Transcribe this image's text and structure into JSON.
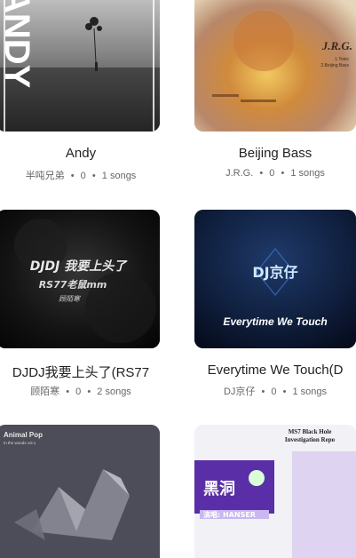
{
  "albums": [
    {
      "title": "Andy",
      "artist": "半吨兄弟",
      "plays": "0",
      "songs": "1 songs",
      "cover_text": "ANDY",
      "cover_accent": "#ffffff"
    },
    {
      "title": "Beijing Bass",
      "artist": "J.R.G.",
      "plays": "0",
      "songs": "1 songs",
      "cover_text": "J.R.G.",
      "cover_sub": "1.Tonic\n2.Beijing Bass",
      "cover_accent": "#e0b04c"
    },
    {
      "title": "DJDJ我要上头了(RS77",
      "artist": "顾陌寒",
      "plays": "0",
      "songs": "2 songs",
      "cover_lines": [
        "DJDJ 我要上头了",
        "RS77老鼠mm",
        "顾陌寒"
      ]
    },
    {
      "title": "Everytime We Touch(D",
      "artist": "DJ京仔",
      "plays": "0",
      "songs": "1 songs",
      "cover_logo": "DJ京仔",
      "cover_line": "Everytime We Touch"
    },
    {
      "title": "",
      "artist": "",
      "plays": "",
      "songs": "",
      "cover_text": "Animal Pop",
      "cover_sub": "In the woods vol.1"
    },
    {
      "title": "",
      "artist": "",
      "plays": "",
      "songs": "",
      "cover_top": "MS7 Black Hole\nInvestigation Repo",
      "cover_big": "黑洞",
      "cover_tag": "演唱: HANSER"
    }
  ],
  "separator": "•"
}
